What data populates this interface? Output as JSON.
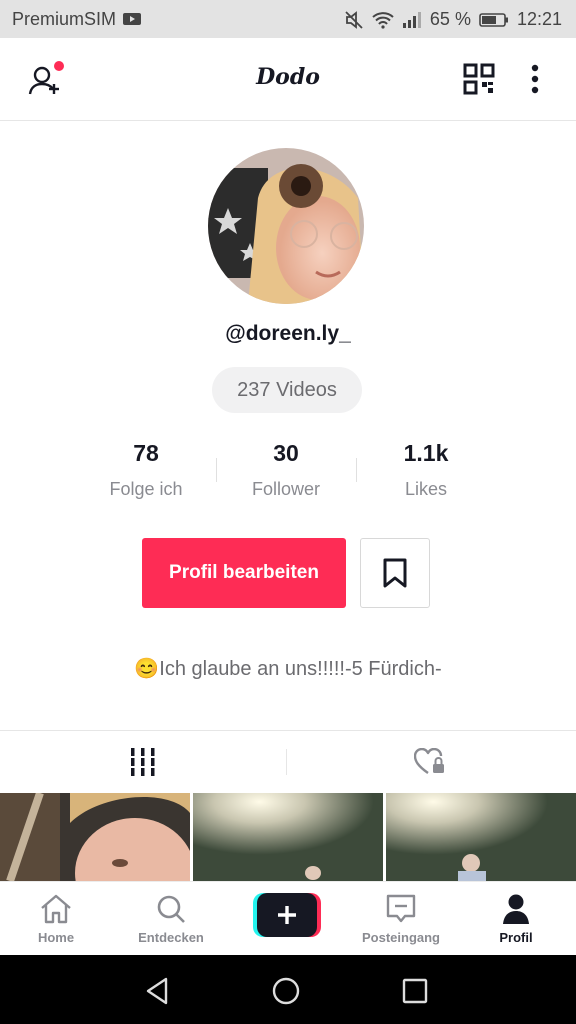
{
  "status_bar": {
    "carrier": "PremiumSIM",
    "battery": "65 %",
    "time": "12:21"
  },
  "header": {
    "title": "Dodo",
    "icons": [
      "add-friend-icon",
      "qr-code-icon",
      "more-vertical-icon"
    ]
  },
  "profile": {
    "username": "@doreen.ly_",
    "videos_label": "237 Videos",
    "stats": [
      {
        "value": "78",
        "label": "Folge ich"
      },
      {
        "value": "30",
        "label": "Follower"
      },
      {
        "value": "1.1k",
        "label": "Likes"
      }
    ],
    "edit_label": "Profil bearbeiten",
    "bio": "😊Ich glaube an uns!!!!!-5 Fürdich-"
  },
  "tabs": [
    "videos-grid-icon",
    "liked-private-icon"
  ],
  "bottom_nav": {
    "home": "Home",
    "discover": "Entdecken",
    "inbox": "Posteingang",
    "profile": "Profil"
  },
  "colors": {
    "accent": "#fe2c55",
    "text": "#161823",
    "muted": "#8a8b91"
  }
}
